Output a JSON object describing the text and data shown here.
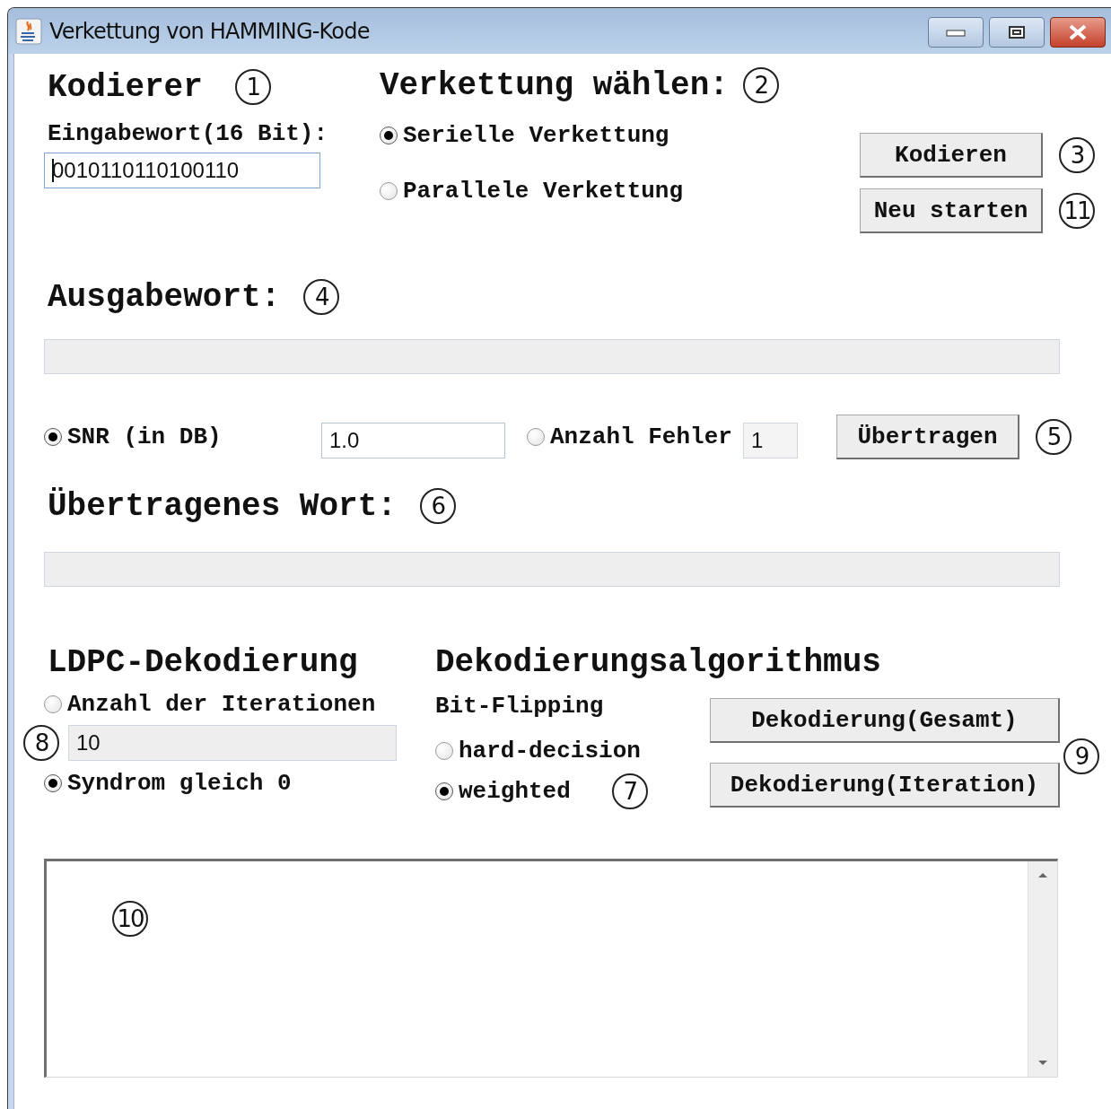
{
  "window": {
    "title": "Verkettung von HAMMING-Kode"
  },
  "encoder": {
    "heading": "Kodierer",
    "callout": "1",
    "input_label": "Eingabewort(16 Bit):",
    "input_value": "0010110110100110"
  },
  "concatenation": {
    "heading": "Verkettung wählen:",
    "callout": "2",
    "options": [
      {
        "label": "Serielle Verkettung",
        "selected": true
      },
      {
        "label": "Parallele Verkettung",
        "selected": false
      }
    ]
  },
  "encode_buttons": [
    {
      "label": "Kodieren",
      "callout": "3"
    },
    {
      "label": "Neu starten",
      "callout": "11"
    }
  ],
  "output": {
    "heading": "Ausgabewort:",
    "callout": "4"
  },
  "channel": {
    "snr": {
      "label": "SNR (in DB)",
      "selected": true,
      "value": "1.0"
    },
    "errors": {
      "label": "Anzahl Fehler",
      "selected": false,
      "value": "1"
    },
    "button": "Übertragen",
    "callout": "5"
  },
  "transmitted": {
    "heading": "Übertragenes Wort:",
    "callout": "6"
  },
  "ldpc": {
    "heading": "LDPC-Dekodierung",
    "stop_options": [
      {
        "label": "Anzahl der Iterationen",
        "selected": false
      },
      {
        "label": "Syndrom gleich 0",
        "selected": true
      }
    ],
    "iterations_value": "10",
    "iterations_callout": "8"
  },
  "algorithm": {
    "heading": "Dekodierungsalgorithmus",
    "subheading": "Bit-Flipping",
    "options": [
      {
        "label": "hard-decision",
        "selected": false
      },
      {
        "label": "weighted",
        "selected": true
      }
    ],
    "callout": "7"
  },
  "decode_buttons": {
    "labels": [
      "Dekodierung(Gesamt)",
      "Dekodierung(Iteration)"
    ],
    "callout": "9"
  },
  "log": {
    "callout": "10"
  }
}
